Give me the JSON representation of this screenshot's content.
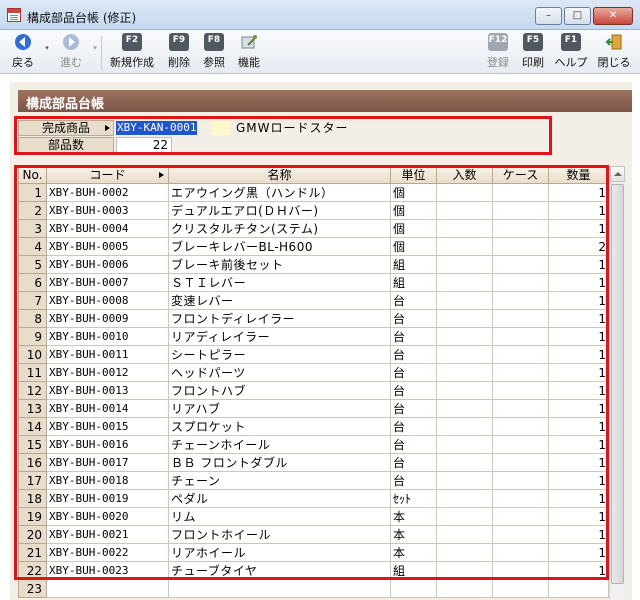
{
  "window": {
    "title": "構成部品台帳 (修正)",
    "buttons": {
      "minimize": "–",
      "maximize": "□",
      "close": "✕"
    }
  },
  "toolbar": {
    "back": "戻る",
    "forward": "進む",
    "new": {
      "key": "F2",
      "label": "新規作成"
    },
    "delete": {
      "key": "F9",
      "label": "削除"
    },
    "reference": {
      "key": "F8",
      "label": "参照"
    },
    "function": {
      "label": "機能"
    },
    "register": {
      "key": "F12",
      "label": "登録"
    },
    "print": {
      "key": "F5",
      "label": "印刷"
    },
    "help": {
      "key": "F1",
      "label": "ヘルプ"
    },
    "close": {
      "label": "閉じる"
    }
  },
  "section": {
    "title": "構成部品台帳"
  },
  "header": {
    "product_label": "完成商品",
    "product_code": "XBY-KAN-0001",
    "product_name": "GMWロードスター",
    "count_label": "部品数",
    "count_value": "22"
  },
  "grid": {
    "columns": [
      "No.",
      "コード",
      "名称",
      "単位",
      "入数",
      "ケース",
      "数量"
    ],
    "rows": [
      {
        "no": "1",
        "code": "XBY-BUH-0002",
        "name": "エアウイング黒（ハンドル）",
        "unit": "個",
        "qty": "1"
      },
      {
        "no": "2",
        "code": "XBY-BUH-0003",
        "name": "デュアルエアロ(ＤＨバー)",
        "unit": "個",
        "qty": "1"
      },
      {
        "no": "3",
        "code": "XBY-BUH-0004",
        "name": "クリスタルチタン(ステム)",
        "unit": "個",
        "qty": "1"
      },
      {
        "no": "4",
        "code": "XBY-BUH-0005",
        "name": "ブレーキレバーBL-H600",
        "unit": "個",
        "qty": "2"
      },
      {
        "no": "5",
        "code": "XBY-BUH-0006",
        "name": "ブレーキ前後セット",
        "unit": "組",
        "qty": "1"
      },
      {
        "no": "6",
        "code": "XBY-BUH-0007",
        "name": "ＳＴＩレバー",
        "unit": "組",
        "qty": "1"
      },
      {
        "no": "7",
        "code": "XBY-BUH-0008",
        "name": "変速レバー",
        "unit": "台",
        "qty": "1"
      },
      {
        "no": "8",
        "code": "XBY-BUH-0009",
        "name": "フロントディレイラー",
        "unit": "台",
        "qty": "1"
      },
      {
        "no": "9",
        "code": "XBY-BUH-0010",
        "name": "リアディレイラー",
        "unit": "台",
        "qty": "1"
      },
      {
        "no": "10",
        "code": "XBY-BUH-0011",
        "name": "シートピラー",
        "unit": "台",
        "qty": "1"
      },
      {
        "no": "11",
        "code": "XBY-BUH-0012",
        "name": "ヘッドパーツ",
        "unit": "台",
        "qty": "1"
      },
      {
        "no": "12",
        "code": "XBY-BUH-0013",
        "name": "フロントハブ",
        "unit": "台",
        "qty": "1"
      },
      {
        "no": "13",
        "code": "XBY-BUH-0014",
        "name": "リアハブ",
        "unit": "台",
        "qty": "1"
      },
      {
        "no": "14",
        "code": "XBY-BUH-0015",
        "name": "スプロケット",
        "unit": "台",
        "qty": "1"
      },
      {
        "no": "15",
        "code": "XBY-BUH-0016",
        "name": "チェーンホイール",
        "unit": "台",
        "qty": "1"
      },
      {
        "no": "16",
        "code": "XBY-BUH-0017",
        "name": "ＢＢ フロントダブル",
        "unit": "台",
        "qty": "1"
      },
      {
        "no": "17",
        "code": "XBY-BUH-0018",
        "name": "チェーン",
        "unit": "台",
        "qty": "1"
      },
      {
        "no": "18",
        "code": "XBY-BUH-0019",
        "name": "ペダル",
        "unit": "ｾｯﾄ",
        "qty": "1"
      },
      {
        "no": "19",
        "code": "XBY-BUH-0020",
        "name": "リム",
        "unit": "本",
        "qty": "1"
      },
      {
        "no": "20",
        "code": "XBY-BUH-0021",
        "name": "フロントホイール",
        "unit": "本",
        "qty": "1"
      },
      {
        "no": "21",
        "code": "XBY-BUH-0022",
        "name": "リアホイール",
        "unit": "本",
        "qty": "1"
      },
      {
        "no": "22",
        "code": "XBY-BUH-0023",
        "name": "チューブタイヤ",
        "unit": "組",
        "qty": "1"
      },
      {
        "no": "23",
        "code": "",
        "name": "",
        "unit": "",
        "qty": ""
      }
    ]
  },
  "colors": {
    "section_bar": "#7a5547",
    "highlight_frame": "#e0141b",
    "selection": "#1f56c9",
    "panel": "#f4efe6"
  }
}
